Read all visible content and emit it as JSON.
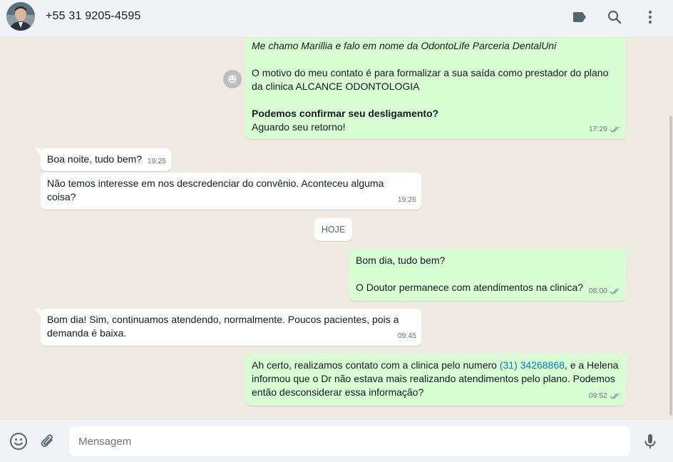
{
  "header": {
    "contact_name": "+55 31 9205-4595",
    "icons": [
      "label-icon",
      "search-icon",
      "menu-icon"
    ]
  },
  "messages": [
    {
      "direction": "outgoing",
      "lines": [
        "Me chamo Marillia e falo em nome da OdontoLife Parceria DentalUni",
        "O motivo do meu contato é para formalizar a sua saída como prestador do plano",
        "da clinica ALCANCE ODONTOLOGIA",
        "Podemos confirmar seu desligamento?",
        "Aguardo seu retorno!"
      ],
      "time": "17:29",
      "status": "read"
    },
    {
      "direction": "incoming",
      "lines": [
        "Boa noite, tudo bem?"
      ],
      "time": "19:25"
    },
    {
      "direction": "incoming",
      "lines": [
        "Não temos interesse em nos descredenciar do convênio.  Aconteceu alguma",
        "coisa?"
      ],
      "time": "19:26"
    },
    {
      "direction": "outgoing",
      "lines": [
        "Bom dia, tudo bem?",
        "O Doutor permanece com atendimentos na clinica?"
      ],
      "time": "08:00",
      "status": "read"
    },
    {
      "direction": "incoming",
      "lines": [
        "Bom dia! Sim, continuamos atendendo, normalmente. Poucos pacientes, pois a",
        "demanda é baixa."
      ],
      "time": "09:45"
    },
    {
      "direction": "outgoing",
      "line1_pre": "Ah certo, realizamos contato com a clinica pelo numero ",
      "phone_link": "(31) 34268868",
      "line1_post": ", e a Helena",
      "lines": [
        "informou que o Dr não estava mais realizando atendimentos pelo plano. Podemos",
        "então desconsiderar essa informação?"
      ],
      "time": "09:52",
      "status": "read"
    }
  ],
  "day_separator": "HOJE",
  "composer": {
    "placeholder": "Mensagem",
    "value": ""
  },
  "colors": {
    "outgoing_bubble": "#d9fdd3",
    "incoming_bubble": "#ffffff",
    "chat_background": "#efeae2",
    "link": "#027eb5",
    "read_ticks": "#8696a0"
  }
}
